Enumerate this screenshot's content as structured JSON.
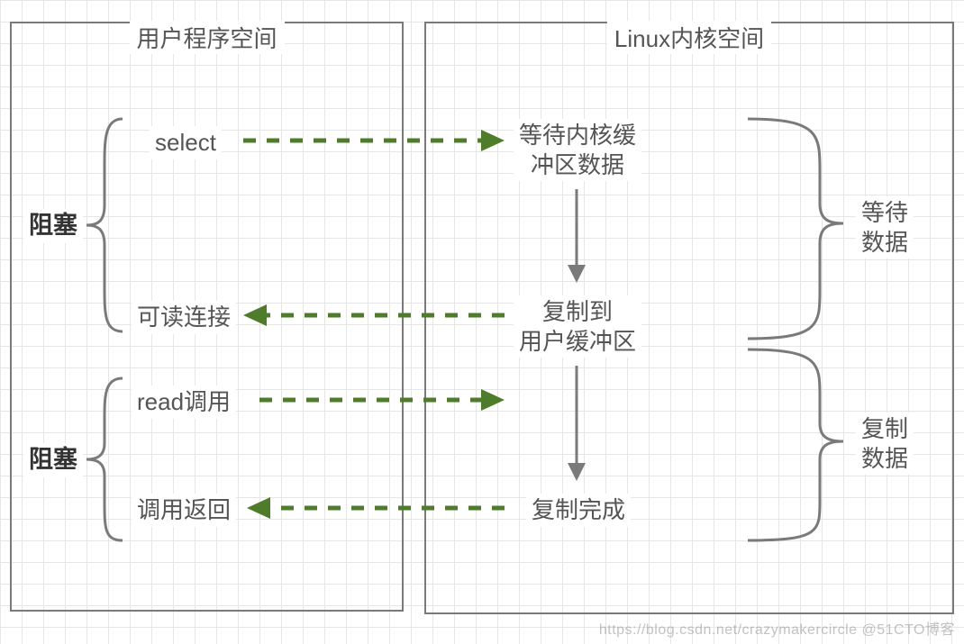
{
  "boxes": {
    "user_space_title": "用户程序空间",
    "kernel_space_title": "Linux内核空间"
  },
  "left": {
    "block_top": "阻塞",
    "block_bottom": "阻塞",
    "select": "select",
    "readable": "可读连接",
    "read_call": "read调用",
    "return": "调用返回"
  },
  "right": {
    "wait_buffer_l1": "等待内核缓",
    "wait_buffer_l2": "冲区数据",
    "copy_user_l1": "复制到",
    "copy_user_l2": "用户缓冲区",
    "copy_done": "复制完成",
    "phase_wait_l1": "等待",
    "phase_wait_l2": "数据",
    "phase_copy_l1": "复制",
    "phase_copy_l2": "数据"
  },
  "watermark": "https://blog.csdn.net/crazymakercircle  @51CTO博客"
}
